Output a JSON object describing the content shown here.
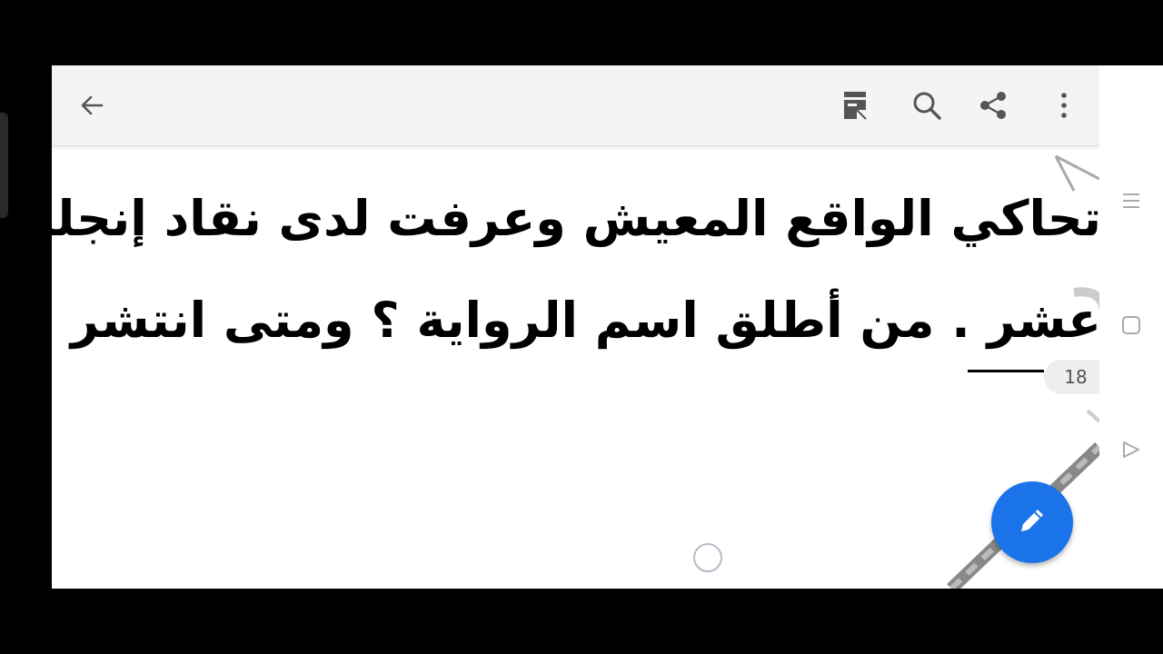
{
  "toolbar": {
    "back_icon": "arrow-back-icon",
    "layout_icon": "page-layout-icon",
    "search_icon": "search-icon",
    "share_icon": "share-icon",
    "more_icon": "more-vertical-icon",
    "background": "#f4f4f4"
  },
  "document": {
    "line1": "تحاكي الواقع المعيش وعرفت لدى نقاد إنجلترا بالرو",
    "line2": "عشر .   من أطلق اسم الرواية ؟ ومتى انتشر الاسم؟",
    "page_number": "18"
  },
  "fab": {
    "icon": "pencil-icon",
    "color": "#1a73e8"
  },
  "sidebar": {
    "items": [
      {
        "icon": "menu-lines-icon"
      },
      {
        "icon": "square-icon"
      },
      {
        "icon": "play-triangle-icon"
      }
    ]
  }
}
